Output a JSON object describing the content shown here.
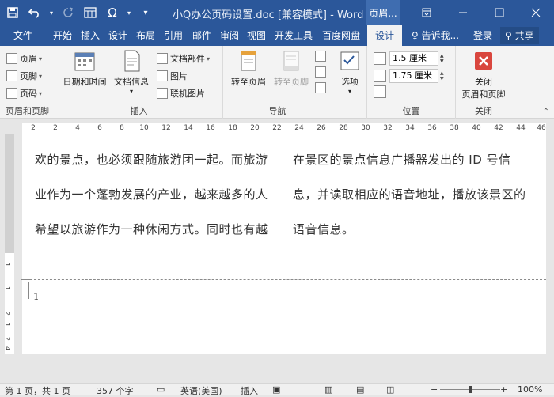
{
  "title_bar": {
    "doc_title": "小Q办公页码设置.doc [兼容模式] - Word",
    "context_tab_title": "页眉...",
    "qat_icons": [
      "save-icon",
      "undo-icon",
      "redo-icon",
      "form-icon",
      "symbol-icon",
      "customize-icon"
    ],
    "symbol_label": "Ω",
    "window_buttons": [
      "ribbon-display-icon",
      "minimize-icon",
      "maximize-icon",
      "close-icon"
    ]
  },
  "tabs": [
    {
      "label": "文件"
    },
    {
      "label": "开始"
    },
    {
      "label": "插入"
    },
    {
      "label": "设计"
    },
    {
      "label": "布局"
    },
    {
      "label": "引用"
    },
    {
      "label": "邮件"
    },
    {
      "label": "审阅"
    },
    {
      "label": "视图"
    },
    {
      "label": "开发工具"
    },
    {
      "label": "百度网盘"
    },
    {
      "label": "设计"
    }
  ],
  "tell_me": "告诉我...",
  "login": "登录",
  "share": "共享",
  "ribbon": {
    "groups": {
      "header_footer": {
        "label": "页眉和页脚",
        "items": [
          {
            "label": "页眉"
          },
          {
            "label": "页脚"
          },
          {
            "label": "页码"
          }
        ]
      },
      "insert": {
        "label": "插入",
        "date_time": "日期和时间",
        "doc_info": "文档信息",
        "doc_parts": "文档部件",
        "picture": "图片",
        "online_picture": "联机图片"
      },
      "navigation": {
        "label": "导航",
        "goto_header": "转至页眉",
        "goto_footer": "转至页脚"
      },
      "options": {
        "label": "选项"
      },
      "position": {
        "label": "位置",
        "header_top": "1.5 厘米",
        "footer_bottom": "1.75 厘米"
      },
      "close": {
        "label": "关闭",
        "button_line1": "关闭",
        "button_line2": "页眉和页脚"
      }
    }
  },
  "ruler_ticks": [
    "2",
    "2",
    "4",
    "6",
    "8",
    "10",
    "12",
    "14",
    "16",
    "18",
    "20",
    "22",
    "24",
    "26",
    "28",
    "30",
    "32",
    "34",
    "36",
    "38",
    "40",
    "42",
    "44",
    "46"
  ],
  "vruler_ticks": [
    "1",
    "1",
    "2",
    "1",
    "2",
    "4"
  ],
  "document": {
    "left_column": [
      "欢的景点，也必须跟随旅游团一起。而旅游",
      "业作为一个蓬勃发展的产业，越来越多的人",
      "希望以旅游作为一种休闲方式。同时也有越"
    ],
    "right_column": [
      "在景区的景点信息广播器发出的 ID 号信",
      "息，并读取相应的语音地址，播放该景区的",
      "语音信息。"
    ],
    "footer_page_number": "1"
  },
  "status_bar": {
    "page": "第 1 页，共 1 页",
    "words": "357 个字",
    "language": "英语(美国)",
    "insert_mode": "插入",
    "zoom": "100%"
  },
  "colors": {
    "title_bar": "#2b579a",
    "ribbon_bg": "#f3f3f3",
    "close_button": "#d9463e"
  }
}
